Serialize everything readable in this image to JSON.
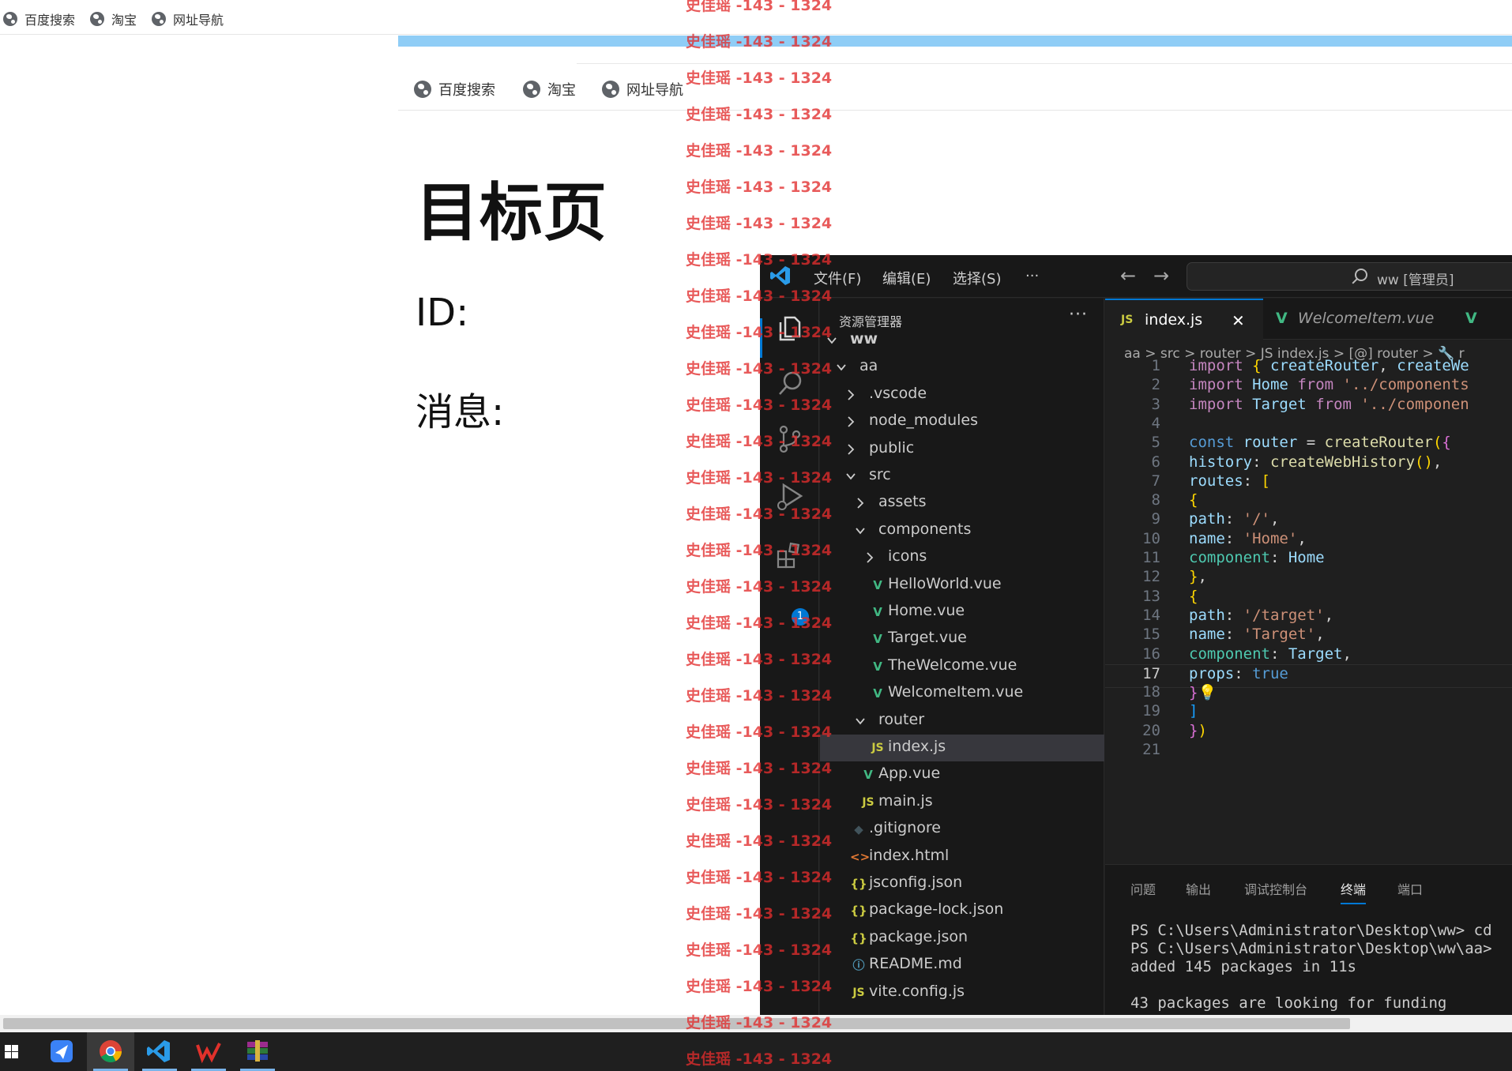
{
  "bookmarks": [
    {
      "label": "百度搜索",
      "icon": "globe-icon"
    },
    {
      "label": "淘宝",
      "icon": "globe-icon"
    },
    {
      "label": "网址导航",
      "icon": "globe-icon"
    }
  ],
  "page": {
    "title": "目标页",
    "id_label": "ID:",
    "message_label": "消息:"
  },
  "watermark": {
    "text": "史佳瑶 -143 - 1324"
  },
  "vscode": {
    "menu": [
      "文件(F)",
      "编辑(E)",
      "选择(S)",
      "···"
    ],
    "search_text": "ww [管理员]",
    "explorer_title": "资源管理器",
    "explorer_more": "···",
    "tree": [
      {
        "label": "ww",
        "type": "folder-open",
        "depth": 0,
        "bold": true
      },
      {
        "label": "aa",
        "type": "folder-open",
        "depth": 1
      },
      {
        "label": ".vscode",
        "type": "folder",
        "depth": 2
      },
      {
        "label": "node_modules",
        "type": "folder",
        "depth": 2
      },
      {
        "label": "public",
        "type": "folder",
        "depth": 2
      },
      {
        "label": "src",
        "type": "folder-open",
        "depth": 2
      },
      {
        "label": "assets",
        "type": "folder",
        "depth": 3
      },
      {
        "label": "components",
        "type": "folder-open",
        "depth": 3
      },
      {
        "label": "icons",
        "type": "folder",
        "depth": 4
      },
      {
        "label": "HelloWorld.vue",
        "type": "vue",
        "depth": 4
      },
      {
        "label": "Home.vue",
        "type": "vue",
        "depth": 4
      },
      {
        "label": "Target.vue",
        "type": "vue",
        "depth": 4
      },
      {
        "label": "TheWelcome.vue",
        "type": "vue",
        "depth": 4
      },
      {
        "label": "WelcomeItem.vue",
        "type": "vue",
        "depth": 4
      },
      {
        "label": "router",
        "type": "folder-open",
        "depth": 3
      },
      {
        "label": "index.js",
        "type": "js",
        "depth": 4,
        "selected": true
      },
      {
        "label": "App.vue",
        "type": "vue",
        "depth": 3
      },
      {
        "label": "main.js",
        "type": "js",
        "depth": 3
      },
      {
        "label": ".gitignore",
        "type": "git",
        "depth": 2
      },
      {
        "label": "index.html",
        "type": "html",
        "depth": 2
      },
      {
        "label": "jsconfig.json",
        "type": "json",
        "depth": 2
      },
      {
        "label": "package-lock.json",
        "type": "json",
        "depth": 2
      },
      {
        "label": "package.json",
        "type": "json",
        "depth": 2
      },
      {
        "label": "README.md",
        "type": "info",
        "depth": 2
      },
      {
        "label": "vite.config.js",
        "type": "js",
        "depth": 2
      }
    ],
    "tabs": [
      {
        "label": "index.js",
        "icon": "JS",
        "active": true,
        "close": "✕"
      },
      {
        "label": "WelcomeItem.vue",
        "icon": "V",
        "active": false
      }
    ],
    "breadcrumb": "aa > src > router > JS index.js > [@] router > 🔧 r",
    "code": [
      "import { createRouter, createWe",
      "import Home from '../components",
      "import Target from '../componen",
      "",
      "const router = createRouter({",
      "history: createWebHistory(),",
      "routes: [",
      "{",
      "path: '/',",
      "name: 'Home',",
      "component: Home",
      "},",
      "{",
      "path: '/target',",
      "name: 'Target',",
      "component: Target,",
      "props: true",
      "}💡",
      "]",
      "})",
      ""
    ],
    "current_line": 17,
    "panel_tabs": [
      "问题",
      "输出",
      "调试控制台",
      "终端",
      "端口"
    ],
    "active_panel_tab": "终端",
    "terminal": [
      "PS C:\\Users\\Administrator\\Desktop\\ww> cd",
      "PS C:\\Users\\Administrator\\Desktop\\ww\\aa>",
      "added 145 packages in 11s",
      "",
      "43 packages are looking for funding"
    ],
    "extensions_badge": "1"
  },
  "taskbar": [
    "windows-start",
    "feishu",
    "chrome",
    "vscode",
    "wps",
    "winrar"
  ]
}
